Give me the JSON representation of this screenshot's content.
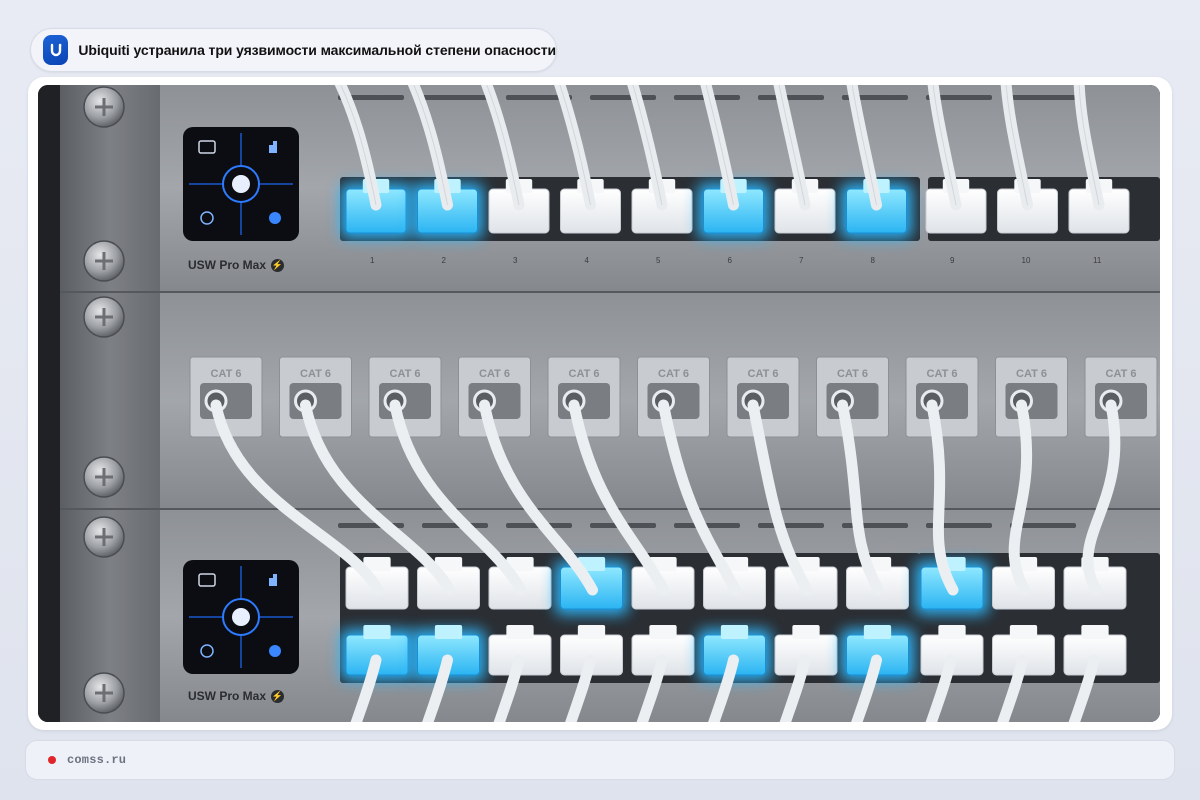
{
  "article": {
    "title": "Ubiquiti устранила три уязвимости максимальной степени опасности",
    "logo_icon": "ubiquiti-logo-icon",
    "brand_color": "#1560d4"
  },
  "photo": {
    "device_label": "USW Pro Max",
    "patch_label": "CAT 6",
    "top_port_labels": [
      "1",
      "2",
      "3",
      "4",
      "5",
      "6",
      "7",
      "8",
      "9",
      "10",
      "11"
    ],
    "top_lit_ports": [
      1,
      2,
      6,
      8
    ],
    "bottom_lit_upper": [
      4,
      9
    ],
    "bottom_lit_lower": [
      1,
      2,
      6,
      8
    ]
  },
  "source": {
    "label": "comss.ru",
    "dot_color": "#e0262a"
  }
}
